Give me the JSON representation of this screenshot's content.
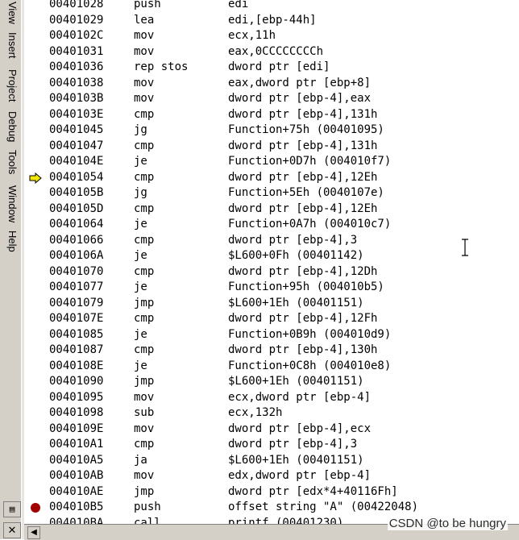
{
  "menu": {
    "items": [
      "View",
      "Insert",
      "Project",
      "Debug",
      "Tools",
      "Window",
      "Help"
    ]
  },
  "disassembly": [
    {
      "addr": "00401028",
      "mnem": "push",
      "ops": "edi"
    },
    {
      "addr": "00401029",
      "mnem": "lea",
      "ops": "edi,[ebp-44h]"
    },
    {
      "addr": "0040102C",
      "mnem": "mov",
      "ops": "ecx,11h"
    },
    {
      "addr": "00401031",
      "mnem": "mov",
      "ops": "eax,0CCCCCCCCh"
    },
    {
      "addr": "00401036",
      "mnem": "rep stos",
      "ops": "dword ptr [edi]"
    },
    {
      "addr": "00401038",
      "mnem": "mov",
      "ops": "eax,dword ptr [ebp+8]"
    },
    {
      "addr": "0040103B",
      "mnem": "mov",
      "ops": "dword ptr [ebp-4],eax"
    },
    {
      "addr": "0040103E",
      "mnem": "cmp",
      "ops": "dword ptr [ebp-4],131h"
    },
    {
      "addr": "00401045",
      "mnem": "jg",
      "ops": "Function+75h (00401095)"
    },
    {
      "addr": "00401047",
      "mnem": "cmp",
      "ops": "dword ptr [ebp-4],131h"
    },
    {
      "addr": "0040104E",
      "mnem": "je",
      "ops": "Function+0D7h (004010f7)"
    },
    {
      "addr": "00401054",
      "mnem": "cmp",
      "ops": "dword ptr [ebp-4],12Eh"
    },
    {
      "addr": "0040105B",
      "mnem": "jg",
      "ops": "Function+5Eh (0040107e)"
    },
    {
      "addr": "0040105D",
      "mnem": "cmp",
      "ops": "dword ptr [ebp-4],12Eh"
    },
    {
      "addr": "00401064",
      "mnem": "je",
      "ops": "Function+0A7h (004010c7)"
    },
    {
      "addr": "00401066",
      "mnem": "cmp",
      "ops": "dword ptr [ebp-4],3"
    },
    {
      "addr": "0040106A",
      "mnem": "je",
      "ops": "$L600+0Fh (00401142)"
    },
    {
      "addr": "00401070",
      "mnem": "cmp",
      "ops": "dword ptr [ebp-4],12Dh"
    },
    {
      "addr": "00401077",
      "mnem": "je",
      "ops": "Function+95h (004010b5)"
    },
    {
      "addr": "00401079",
      "mnem": "jmp",
      "ops": "$L600+1Eh (00401151)"
    },
    {
      "addr": "0040107E",
      "mnem": "cmp",
      "ops": "dword ptr [ebp-4],12Fh"
    },
    {
      "addr": "00401085",
      "mnem": "je",
      "ops": "Function+0B9h (004010d9)"
    },
    {
      "addr": "00401087",
      "mnem": "cmp",
      "ops": "dword ptr [ebp-4],130h"
    },
    {
      "addr": "0040108E",
      "mnem": "je",
      "ops": "Function+0C8h (004010e8)"
    },
    {
      "addr": "00401090",
      "mnem": "jmp",
      "ops": "$L600+1Eh (00401151)"
    },
    {
      "addr": "00401095",
      "mnem": "mov",
      "ops": "ecx,dword ptr [ebp-4]"
    },
    {
      "addr": "00401098",
      "mnem": "sub",
      "ops": "ecx,132h"
    },
    {
      "addr": "0040109E",
      "mnem": "mov",
      "ops": "dword ptr [ebp-4],ecx"
    },
    {
      "addr": "004010A1",
      "mnem": "cmp",
      "ops": "dword ptr [ebp-4],3"
    },
    {
      "addr": "004010A5",
      "mnem": "ja",
      "ops": "$L600+1Eh (00401151)"
    },
    {
      "addr": "004010AB",
      "mnem": "mov",
      "ops": "edx,dword ptr [ebp-4]"
    },
    {
      "addr": "004010AE",
      "mnem": "jmp",
      "ops": "dword ptr [edx*4+40116Fh]"
    },
    {
      "addr": "004010B5",
      "mnem": "push",
      "ops": "offset string \"A\" (00422048)"
    },
    {
      "addr": "004010BA",
      "mnem": "call",
      "ops": "printf (00401230)"
    }
  ],
  "current_line_index": 11,
  "breakpoint_line_index": 32,
  "watermark": "CSDN @to be hungry",
  "colors": {
    "arrow": "#f3e600",
    "breakpoint": "#a00000"
  }
}
